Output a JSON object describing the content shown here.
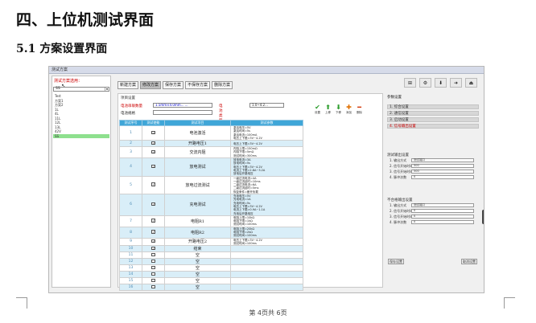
{
  "document": {
    "heading": "四、上位机测试界面",
    "subheading": "5.1 方案设置界面",
    "footer": "第 4页共 6页"
  },
  "screenshot": {
    "window_title": "测试方案",
    "left_panel": {
      "label": "测试方案选用：",
      "selected": "SS",
      "items": [
        "Test",
        "方案1",
        "方案2",
        "1L",
        "4L",
        "11L",
        "12L",
        "13L",
        "42V",
        "SS"
      ],
      "highlighted_index": 9
    },
    "tabs": [
      {
        "label": "新建方案",
        "active": false
      },
      {
        "label": "修改方案",
        "active": true
      },
      {
        "label": "保存方案",
        "active": false
      },
      {
        "label": "不保存方案",
        "active": false
      },
      {
        "label": "删除方案",
        "active": false
      }
    ],
    "toolbar_icons": [
      "network-icon",
      "gear-icon",
      "download-icon",
      "arrow-right-icon",
      "exit-icon"
    ],
    "middle": {
      "caption": "项目设置",
      "field1_label": "电池串联数量",
      "field1_value": "1.5mm×4.0mm... ...",
      "field2_label": "电池类型",
      "field2_value": "1.0~4.2...",
      "field3_label": "电池规格",
      "actions": [
        {
          "label": "设置",
          "glyph": "✔",
          "color": "#2e9e2e"
        },
        {
          "label": "上移",
          "glyph": "⬆",
          "color": "#2e9e2e"
        },
        {
          "label": "下移",
          "glyph": "⬇",
          "color": "#2e9e2e"
        },
        {
          "label": "添加",
          "glyph": "✚",
          "color": "#e07000"
        },
        {
          "label": "删除",
          "glyph": "━",
          "color": "#d03000"
        }
      ],
      "table": {
        "headers": [
          "测试序号",
          "测试使能",
          "测试项目",
          "测试参数"
        ],
        "rows": [
          {
            "no": "1",
            "checked": true,
            "name": "电池激活",
            "params": [
              "激活电压=5V",
              "激活时间=5s",
              "激活电流=100mA",
              "电压上下限=3V~4.2V"
            ]
          },
          {
            "no": "2",
            "checked": true,
            "name": "开路电压1",
            "params": [
              "电压上下限=3V~4.2V"
            ]
          },
          {
            "no": "3",
            "checked": true,
            "name": "交流内阻",
            "params": [
              "内阻上限=150mΩ",
              "内阻下限=5mΩ",
              "测试时间=300ms"
            ]
          },
          {
            "no": "4",
            "checked": true,
            "name": "放电测试",
            "params": [
              "放电电流=3A",
              "放电时间=5s",
              "电压上下限=3V~4.2V",
              "电流上下限=2.8A~3.2A",
              "放电后开路电压"
            ]
          },
          {
            "no": "5",
            "checked": true,
            "name": "放电过流测试",
            "params": [
              "一级过流电流=4A",
              "一级过流延时=10ms",
              "二级过流电流=6A",
              "二级过流延时=5ms",
              "恢复条件=断开负载"
            ]
          },
          {
            "no": "6",
            "checked": true,
            "name": "充电测试",
            "params": [
              "充电电压=5V",
              "充电电流=1A",
              "充电时间=5s",
              "电压上下限=3V~4.2V",
              "电流上下限=0.9A~1.1A",
              "充电后开路电压"
            ]
          },
          {
            "no": "7",
            "checked": true,
            "name": "电阻R1",
            "params": [
              "电阻上限=10kΩ",
              "电阻下限=1kΩ",
              "测试时间=100ms"
            ]
          },
          {
            "no": "8",
            "checked": true,
            "name": "电阻R2",
            "params": [
              "电阻上限=20kΩ",
              "电阻下限=2kΩ",
              "测试时间=100ms"
            ]
          },
          {
            "no": "9",
            "checked": true,
            "name": "开路电压2",
            "params": [
              "电压上下限=3V~4.2V",
              "测试时间=100ms"
            ]
          },
          {
            "no": "10",
            "checked": true,
            "name": "结束",
            "params": []
          },
          {
            "no": "11",
            "checked": false,
            "name": "空",
            "params": []
          },
          {
            "no": "12",
            "checked": false,
            "name": "空",
            "params": []
          },
          {
            "no": "13",
            "checked": false,
            "name": "空",
            "params": []
          },
          {
            "no": "14",
            "checked": false,
            "name": "空",
            "params": []
          },
          {
            "no": "15",
            "checked": false,
            "name": "空",
            "params": []
          },
          {
            "no": "16",
            "checked": false,
            "name": "空",
            "params": []
          }
        ]
      }
    },
    "right": {
      "caption": "参数设置",
      "steps": [
        {
          "label": "1. 综合设置",
          "red": false
        },
        {
          "label": "2. 通信设置",
          "red": false
        },
        {
          "label": "3. 启动设置",
          "red": false
        },
        {
          "label": "4. 信号输出设置",
          "red": true
        }
      ],
      "group1_title": "测试输出设置",
      "group1_items": [
        {
          "label": "1. 输出方式",
          "value": "测试端口"
        },
        {
          "label": "2. 信号开始时间(mS)",
          "value": "500"
        },
        {
          "label": "3. 信号开始时间(mS)",
          "value": "500"
        },
        {
          "label": "4. 脉冲次数",
          "value": "0"
        }
      ],
      "group2_title": "不合格输出设置",
      "group2_items": [
        {
          "label": "1. 输出方式",
          "value": "测试端口"
        },
        {
          "label": "2. 信号开始时间(mS)",
          "value": "0"
        },
        {
          "label": "3. 信号开始时间(mS)",
          "value": "0"
        },
        {
          "label": "4. 脉冲次数",
          "value": "0"
        }
      ],
      "btn_left": "保存设置",
      "btn_right": "取消设置"
    }
  }
}
